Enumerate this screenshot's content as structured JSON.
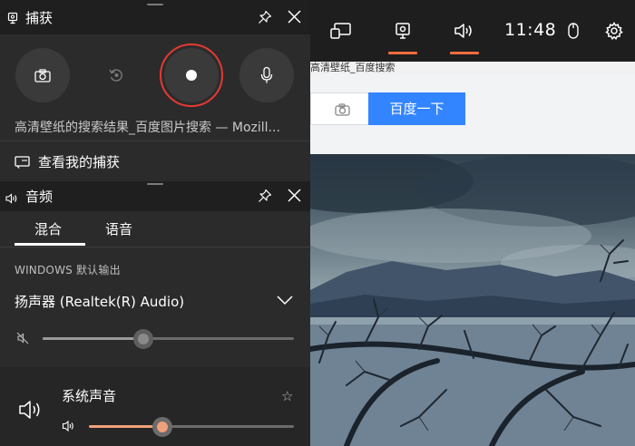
{
  "capture_widget": {
    "title": "捕获",
    "target_window": "高清壁纸的搜索结果_百度图片搜索 — Mozill...",
    "view_captures_label": "查看我的捕获"
  },
  "audio_widget": {
    "title": "音频",
    "tabs": [
      {
        "label": "混合",
        "active": true
      },
      {
        "label": "语音",
        "active": false
      }
    ],
    "section_label": "WINDOWS 默认输出",
    "device_name": "扬声器 (Realtek(R) Audio)",
    "device_volume": 0.4,
    "app_name": "系统声音",
    "app_volume": 0.36
  },
  "gamebar": {
    "clock": "11:48"
  },
  "browser": {
    "tab_title": "高清壁纸_百度搜索",
    "search_button": "百度一下"
  },
  "colors": {
    "accent": "#f26d3d",
    "record_ring": "#e53935",
    "baidu_blue": "#3385ff",
    "slider_fill": "#f0a07a"
  }
}
